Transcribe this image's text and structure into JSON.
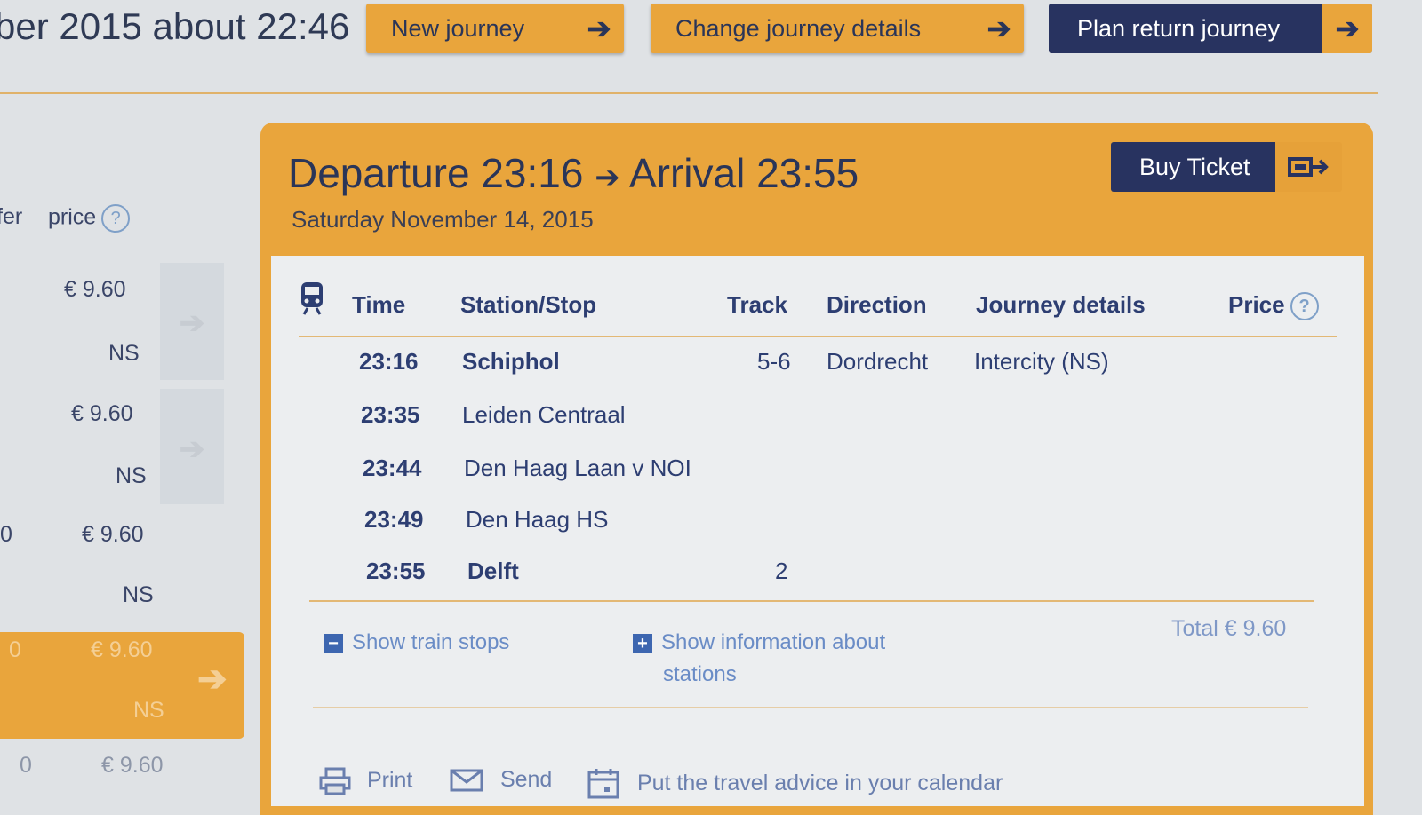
{
  "header": {
    "title_fragment": "ber 2015 about 22:46",
    "new_journey": "New journey",
    "change_details": "Change journey details",
    "plan_return": "Plan return journey"
  },
  "left": {
    "col_transfer": "fer",
    "col_price": "price",
    "rows": [
      {
        "price": "€ 9.60",
        "carrier": "NS",
        "transfers": ""
      },
      {
        "price": "€ 9.60",
        "carrier": "NS",
        "transfers": ""
      },
      {
        "price": "€ 9.60",
        "carrier": "NS",
        "transfers": "0"
      },
      {
        "price": "€ 9.60",
        "carrier": "NS",
        "transfers": "0"
      },
      {
        "price": "€ 9.60",
        "carrier": "",
        "transfers": "0"
      }
    ]
  },
  "journey": {
    "departure_label": "Departure 23:16",
    "arrival_label": "Arrival 23:55",
    "date": "Saturday November 14, 2015",
    "buy_ticket": "Buy Ticket"
  },
  "table": {
    "headers": {
      "time": "Time",
      "station": "Station/Stop",
      "track": "Track",
      "direction": "Direction",
      "details": "Journey details",
      "price": "Price"
    },
    "rows": [
      {
        "time": "23:16",
        "station": "Schiphol",
        "track": "5-6",
        "direction": "Dordrecht",
        "details": "Intercity (NS)"
      },
      {
        "time": "23:35",
        "station": "Leiden Centraal",
        "track": "",
        "direction": "",
        "details": ""
      },
      {
        "time": "23:44",
        "station": "Den Haag Laan v NOI",
        "track": "",
        "direction": "",
        "details": ""
      },
      {
        "time": "23:49",
        "station": "Den Haag HS",
        "track": "",
        "direction": "",
        "details": ""
      },
      {
        "time": "23:55",
        "station": "Delft",
        "track": "2",
        "direction": "",
        "details": ""
      }
    ]
  },
  "actions": {
    "show_stops": "Show train stops",
    "show_info_1": "Show information about",
    "show_info_2": "stations",
    "total": "Total € 9.60"
  },
  "footer": {
    "print": "Print",
    "send": "Send",
    "calendar": "Put the travel advice in your calendar"
  },
  "colors": {
    "orange": "#e9a53c",
    "navy": "#283360",
    "link": "#6a8cc6"
  }
}
